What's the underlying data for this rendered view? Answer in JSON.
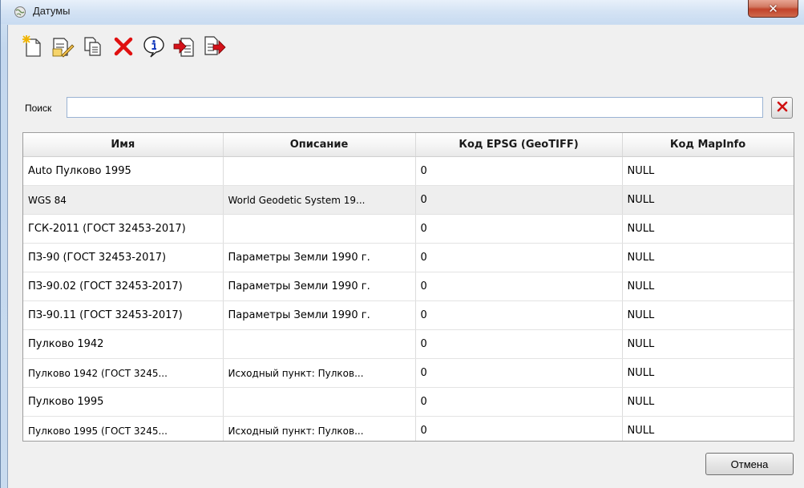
{
  "window": {
    "title": "Датумы",
    "close_glyph": "✕"
  },
  "toolbar": {
    "icons": [
      "new-icon",
      "edit-icon",
      "copy-icon",
      "delete-icon",
      "info-icon",
      "import-icon",
      "export-icon"
    ]
  },
  "search": {
    "label": "Поиск",
    "value": "",
    "placeholder": ""
  },
  "table": {
    "headers": [
      "Имя",
      "Описание",
      "Код EPSG (GeoTIFF)",
      "Код MapInfo"
    ],
    "rows": [
      [
        "Auto Пулково 1995",
        "",
        "0",
        "NULL"
      ],
      [
        "WGS 84",
        "World Geodetic System 19...",
        "0",
        "NULL"
      ],
      [
        "ГСК-2011 (ГОСТ 32453-2017)",
        "",
        "0",
        "NULL"
      ],
      [
        "ПЗ-90 (ГОСТ 32453-2017)",
        "Параметры Земли 1990 г.",
        "0",
        "NULL"
      ],
      [
        "ПЗ-90.02 (ГОСТ 32453-2017)",
        "Параметры Земли 1990 г.",
        "0",
        "NULL"
      ],
      [
        "ПЗ-90.11 (ГОСТ 32453-2017)",
        "Параметры Земли 1990 г.",
        "0",
        "NULL"
      ],
      [
        "Пулково 1942",
        "",
        "0",
        "NULL"
      ],
      [
        "Пулково 1942 (ГОСТ 3245...",
        "Исходный пункт: Пулков...",
        "0",
        "NULL"
      ],
      [
        "Пулково 1995",
        "",
        "0",
        "NULL"
      ],
      [
        "Пулково 1995 (ГОСТ 3245...",
        "Исходный пункт: Пулков...",
        "0",
        "NULL"
      ]
    ]
  },
  "footer": {
    "cancel_label": "Отмена"
  }
}
